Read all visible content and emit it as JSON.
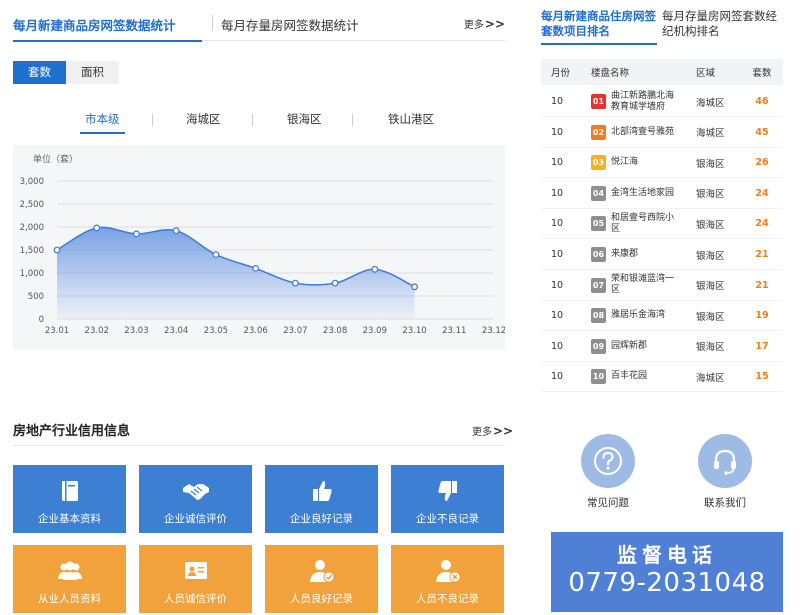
{
  "main_tabs": {
    "active": "每月新建商品房网签数据统计",
    "other": "每月存量房网签数据统计",
    "more": "更多"
  },
  "toggle": [
    "套数",
    "面积"
  ],
  "level_tabs": [
    "市本级",
    "海城区",
    "银海区",
    "铁山港区"
  ],
  "chart_data": {
    "type": "area",
    "unit_label": "单位（套）",
    "categories": [
      "23.01",
      "23.02",
      "23.03",
      "23.04",
      "23.05",
      "23.06",
      "23.07",
      "23.08",
      "23.09",
      "23.10",
      "23.11",
      "23.12"
    ],
    "values": [
      1500,
      1980,
      1850,
      1920,
      1400,
      1100,
      780,
      780,
      1080,
      700,
      null,
      null
    ],
    "ylim": [
      0,
      3000
    ],
    "yticks": [
      "3,000",
      "2,500",
      "2,000",
      "1,500",
      "1,000",
      "500",
      "0"
    ],
    "grid": true,
    "line_color": "#3f7ad8",
    "fill_color": "#4f86e0"
  },
  "credit": {
    "title": "房地产行业信用信息",
    "more": "更多",
    "tiles": [
      {
        "label": "企业基本资料",
        "icon": "book-icon",
        "color": "blue"
      },
      {
        "label": "企业诚信评价",
        "icon": "handshake-icon",
        "color": "blue"
      },
      {
        "label": "企业良好记录",
        "icon": "thumbs-up-icon",
        "color": "blue"
      },
      {
        "label": "企业不良记录",
        "icon": "thumbs-down-icon",
        "color": "blue"
      },
      {
        "label": "从业人员资料",
        "icon": "people-icon",
        "color": "orange"
      },
      {
        "label": "人员诚信评价",
        "icon": "id-card-icon",
        "color": "orange"
      },
      {
        "label": "人员良好记录",
        "icon": "person-check-icon",
        "color": "orange"
      },
      {
        "label": "人员不良记录",
        "icon": "person-cross-icon",
        "color": "orange"
      }
    ]
  },
  "right_tabs": {
    "active": "每月新建商品住房网签套数项目排名",
    "other": "每月存量房网签套数经纪机构排名"
  },
  "ranking": {
    "headers": [
      "月份",
      "楼盘名称",
      "区域",
      "套数"
    ],
    "rows": [
      {
        "month": "10",
        "rank": "01",
        "name": "曲江新路鵬北海教育城学墙府",
        "area": "海城区",
        "count": "46",
        "badge_color": "#e8312e"
      },
      {
        "month": "10",
        "rank": "02",
        "name": "北部湾壹号雅苑",
        "area": "海城区",
        "count": "45",
        "badge_color": "#f47a1f"
      },
      {
        "month": "10",
        "rank": "03",
        "name": "悦江海",
        "area": "银海区",
        "count": "26",
        "badge_color": "#f5b21b"
      },
      {
        "month": "10",
        "rank": "04",
        "name": "金湾生活地家园",
        "area": "银海区",
        "count": "24",
        "badge_color": "#8f8f8f"
      },
      {
        "month": "10",
        "rank": "05",
        "name": "和居壹号西院小区",
        "area": "银海区",
        "count": "24",
        "badge_color": "#8f8f8f"
      },
      {
        "month": "10",
        "rank": "06",
        "name": "来康郡",
        "area": "银海区",
        "count": "21",
        "badge_color": "#8f8f8f"
      },
      {
        "month": "10",
        "rank": "07",
        "name": "荣和银滩蓝湾一区",
        "area": "银海区",
        "count": "21",
        "badge_color": "#8f8f8f"
      },
      {
        "month": "10",
        "rank": "08",
        "name": "雅居乐金海湾",
        "area": "银海区",
        "count": "19",
        "badge_color": "#8f8f8f"
      },
      {
        "month": "10",
        "rank": "09",
        "name": "园辉新郡",
        "area": "银海区",
        "count": "17",
        "badge_color": "#8f8f8f"
      },
      {
        "month": "10",
        "rank": "10",
        "name": "百丰花园",
        "area": "海城区",
        "count": "15",
        "badge_color": "#8f8f8f"
      }
    ]
  },
  "help": {
    "faq": "常见问题",
    "contact": "联系我们"
  },
  "hotline": {
    "title": "监督电话",
    "phone": "0779-2031048"
  }
}
